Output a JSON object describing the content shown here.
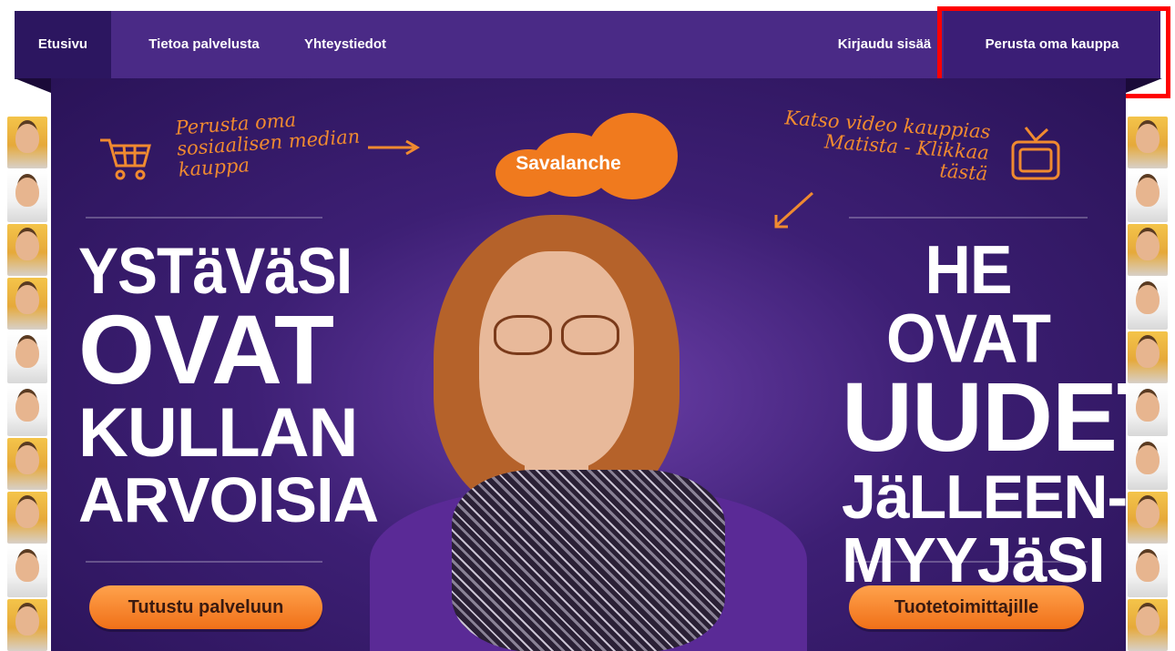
{
  "nav": {
    "home": "Etusivu",
    "about": "Tietoa palvelusta",
    "contact": "Yhteystiedot",
    "login": "Kirjaudu sisää",
    "start_shop": "Perusta oma kauppa"
  },
  "hero": {
    "logo": "Savalanche",
    "note_left": "Perusta oma sosiaalisen median kauppa",
    "note_right": "Katso video kauppias Matista - Klikkaa tästä",
    "left_headline": [
      "YSTäVäSI",
      "OVAT",
      "KULLAN",
      "ARVOISIA"
    ],
    "right_headline": [
      "HE OVAT",
      "UUDET",
      "JäLLEEN-",
      "MYYJäSI"
    ],
    "left_button": "Tutustu palveluun",
    "right_button": "Tuotetoimittajille"
  },
  "colors": {
    "nav_bg": "#4a2a86",
    "hero_bg": "#3d1f74",
    "accent_orange": "#f07a1e",
    "highlight": "#ff0000"
  },
  "icons": [
    "shopping-cart-icon",
    "arrow-right-icon",
    "arrow-down-left-icon",
    "tv-icon"
  ]
}
